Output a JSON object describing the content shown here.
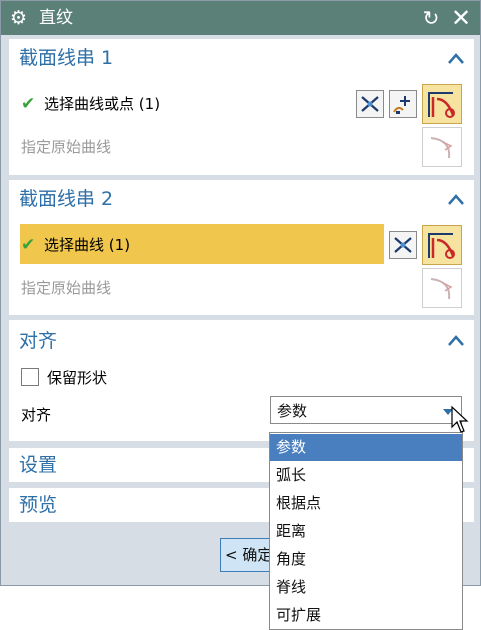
{
  "window": {
    "title": "直纹",
    "gear_icon": "gear-icon",
    "reset_icon": "reset-icon",
    "close_icon": "close-icon"
  },
  "section1": {
    "title": "截面线串 1",
    "select_label": "选择曲线或点 (1)",
    "original_curve_label": "指定原始曲线"
  },
  "section2": {
    "title": "截面线串 2",
    "select_label": "选择曲线 (1)",
    "original_curve_label": "指定原始曲线"
  },
  "alignment": {
    "title": "对齐",
    "keep_shape_label": "保留形状",
    "keep_shape_checked": false,
    "align_label": "对齐",
    "align_value": "参数",
    "options": [
      "参数",
      "弧长",
      "根据点",
      "距离",
      "角度",
      "脊线",
      "可扩展"
    ],
    "selected_option": "参数"
  },
  "settings": {
    "title": "设置"
  },
  "preview": {
    "title": "预览"
  },
  "footer": {
    "ok_label": "< 确定"
  },
  "colors": {
    "title_bar": "#5a8078",
    "section_title": "#2e6fa8",
    "active_row": "#f0c74c",
    "selected_option": "#4a7fbf",
    "check": "#3aa23a"
  }
}
